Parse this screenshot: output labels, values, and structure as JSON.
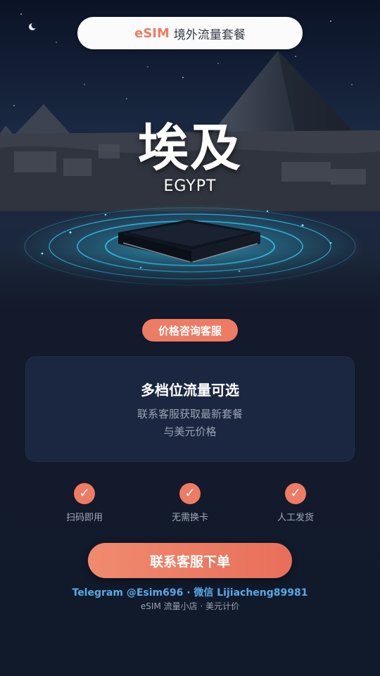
{
  "header": {
    "brand": "eSIM",
    "title": "境外流量套餐"
  },
  "hero": {
    "country_cn": "埃及",
    "country_en": "EGYPT"
  },
  "price_pill": {
    "label": "价格咨询客服"
  },
  "card": {
    "heading": "多档位流量可选",
    "line1": "联系客服获取最新套餐",
    "line2": "与美元价格"
  },
  "features": [
    {
      "icon": "check-icon",
      "label": "扫码即用"
    },
    {
      "icon": "check-icon",
      "label": "无需换卡"
    },
    {
      "icon": "check-icon",
      "label": "人工发货"
    }
  ],
  "cta": {
    "label": "联系客服下单"
  },
  "contact": {
    "text": "Telegram @Esim696 · 微信 Lijiacheng89981"
  },
  "footer": {
    "text": "eSIM 流量小店 · 美元计价"
  },
  "colors": {
    "accent": "#ee7b63",
    "background": "#121a2b",
    "card": "#1b2740",
    "link": "#5aa9e6"
  }
}
